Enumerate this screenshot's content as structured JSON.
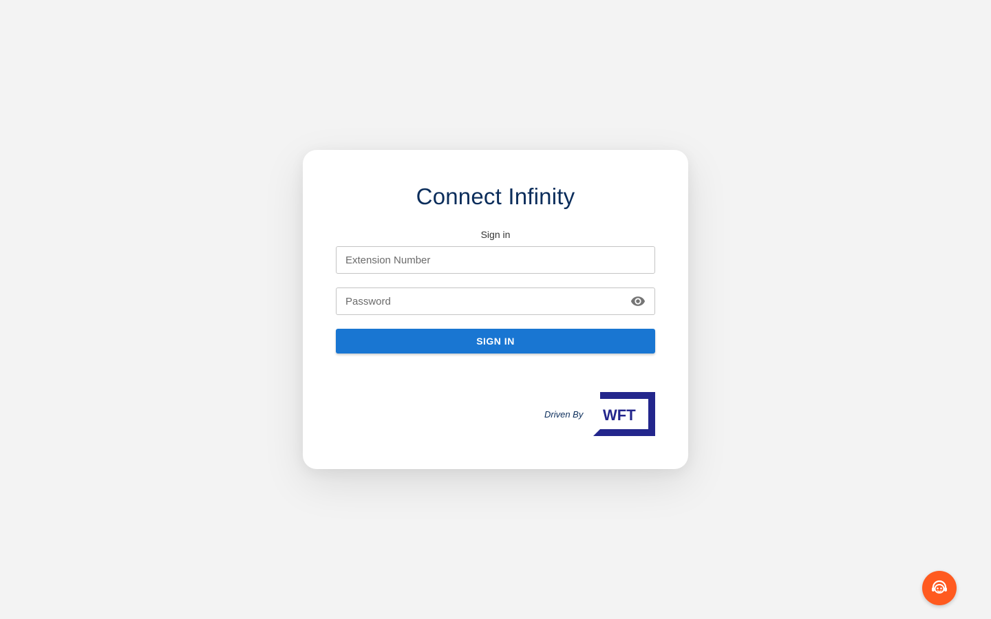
{
  "app": {
    "title": "Connect Infinity",
    "subtitle": "Sign in"
  },
  "form": {
    "extension_placeholder": "Extension Number",
    "extension_value": "",
    "password_placeholder": "Password",
    "password_value": "",
    "submit_label": "SIGN IN",
    "password_toggle_icon": "eye-icon"
  },
  "footer": {
    "driven_by": "Driven By",
    "logo_text": "WFT",
    "logo_color": "#23268c"
  },
  "support": {
    "icon": "chat-support-icon",
    "color": "#ff5a1f"
  },
  "colors": {
    "primary": "#1976d2",
    "title": "#0b2d5b",
    "background": "#f3f3f3"
  }
}
